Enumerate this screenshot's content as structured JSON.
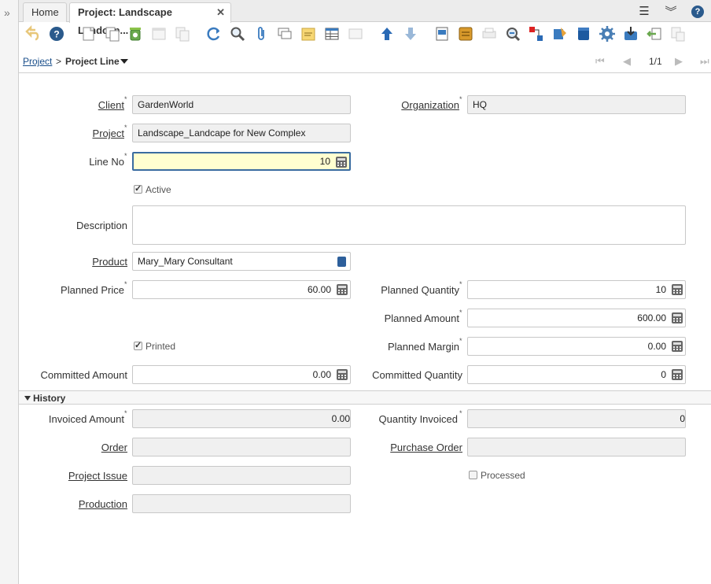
{
  "tabs": {
    "home": "Home",
    "active": "Project: Landscape Landcap..."
  },
  "breadcrumb": {
    "parent": "Project",
    "separator": ">",
    "current": "Project Line"
  },
  "navigation": {
    "first": "⏮",
    "prev": "◀",
    "record_count": "1/1",
    "next": "▶",
    "last": "⏭"
  },
  "fields": {
    "client": {
      "label": "Client",
      "value": "GardenWorld"
    },
    "organization": {
      "label": "Organization",
      "value": "HQ"
    },
    "project": {
      "label": "Project",
      "value": "Landscape_Landcape for New Complex"
    },
    "line_no": {
      "label": "Line No",
      "value": "10"
    },
    "active": {
      "label": "Active",
      "checked": true
    },
    "description": {
      "label": "Description",
      "value": ""
    },
    "product": {
      "label": "Product",
      "value": "Mary_Mary Consultant"
    },
    "planned_price": {
      "label": "Planned Price",
      "value": "60.00"
    },
    "planned_quantity": {
      "label": "Planned Quantity",
      "value": "10"
    },
    "planned_amount": {
      "label": "Planned Amount",
      "value": "600.00"
    },
    "printed": {
      "label": "Printed",
      "checked": true
    },
    "planned_margin": {
      "label": "Planned Margin",
      "value": "0.00"
    },
    "committed_amount": {
      "label": "Committed Amount",
      "value": "0.00"
    },
    "committed_quantity": {
      "label": "Committed Quantity",
      "value": "0"
    }
  },
  "history": {
    "title": "History",
    "invoiced_amount": {
      "label": "Invoiced Amount",
      "value": "0.00"
    },
    "quantity_invoiced": {
      "label": "Quantity Invoiced",
      "value": "0"
    },
    "order": {
      "label": "Order",
      "value": ""
    },
    "purchase_order": {
      "label": "Purchase Order",
      "value": ""
    },
    "project_issue": {
      "label": "Project Issue",
      "value": ""
    },
    "processed": {
      "label": "Processed",
      "checked": false
    },
    "production": {
      "label": "Production",
      "value": ""
    }
  },
  "colors": {
    "link": "#1a4f8b",
    "focus_bg": "#ffffd0",
    "focus_border": "#3a6ca0",
    "readonly_bg": "#f0f0f0"
  },
  "toolbar_icons": [
    "undo-icon",
    "help-icon",
    "new-record-icon",
    "copy-record-icon",
    "delete-icon",
    "delete-selection-icon",
    "save-create-icon",
    "refresh-icon",
    "find-icon",
    "attachment-icon",
    "chat-icon",
    "post-it-icon",
    "grid-toggle-icon",
    "multi-edit-icon",
    "parent-record-icon",
    "detail-record-icon",
    "report-icon",
    "archive-icon",
    "print-icon",
    "zoom-across-icon",
    "request-icon",
    "product-info-icon",
    "quick-form-icon",
    "process-icon",
    "import-icon",
    "export-icon",
    "customize-icon"
  ]
}
